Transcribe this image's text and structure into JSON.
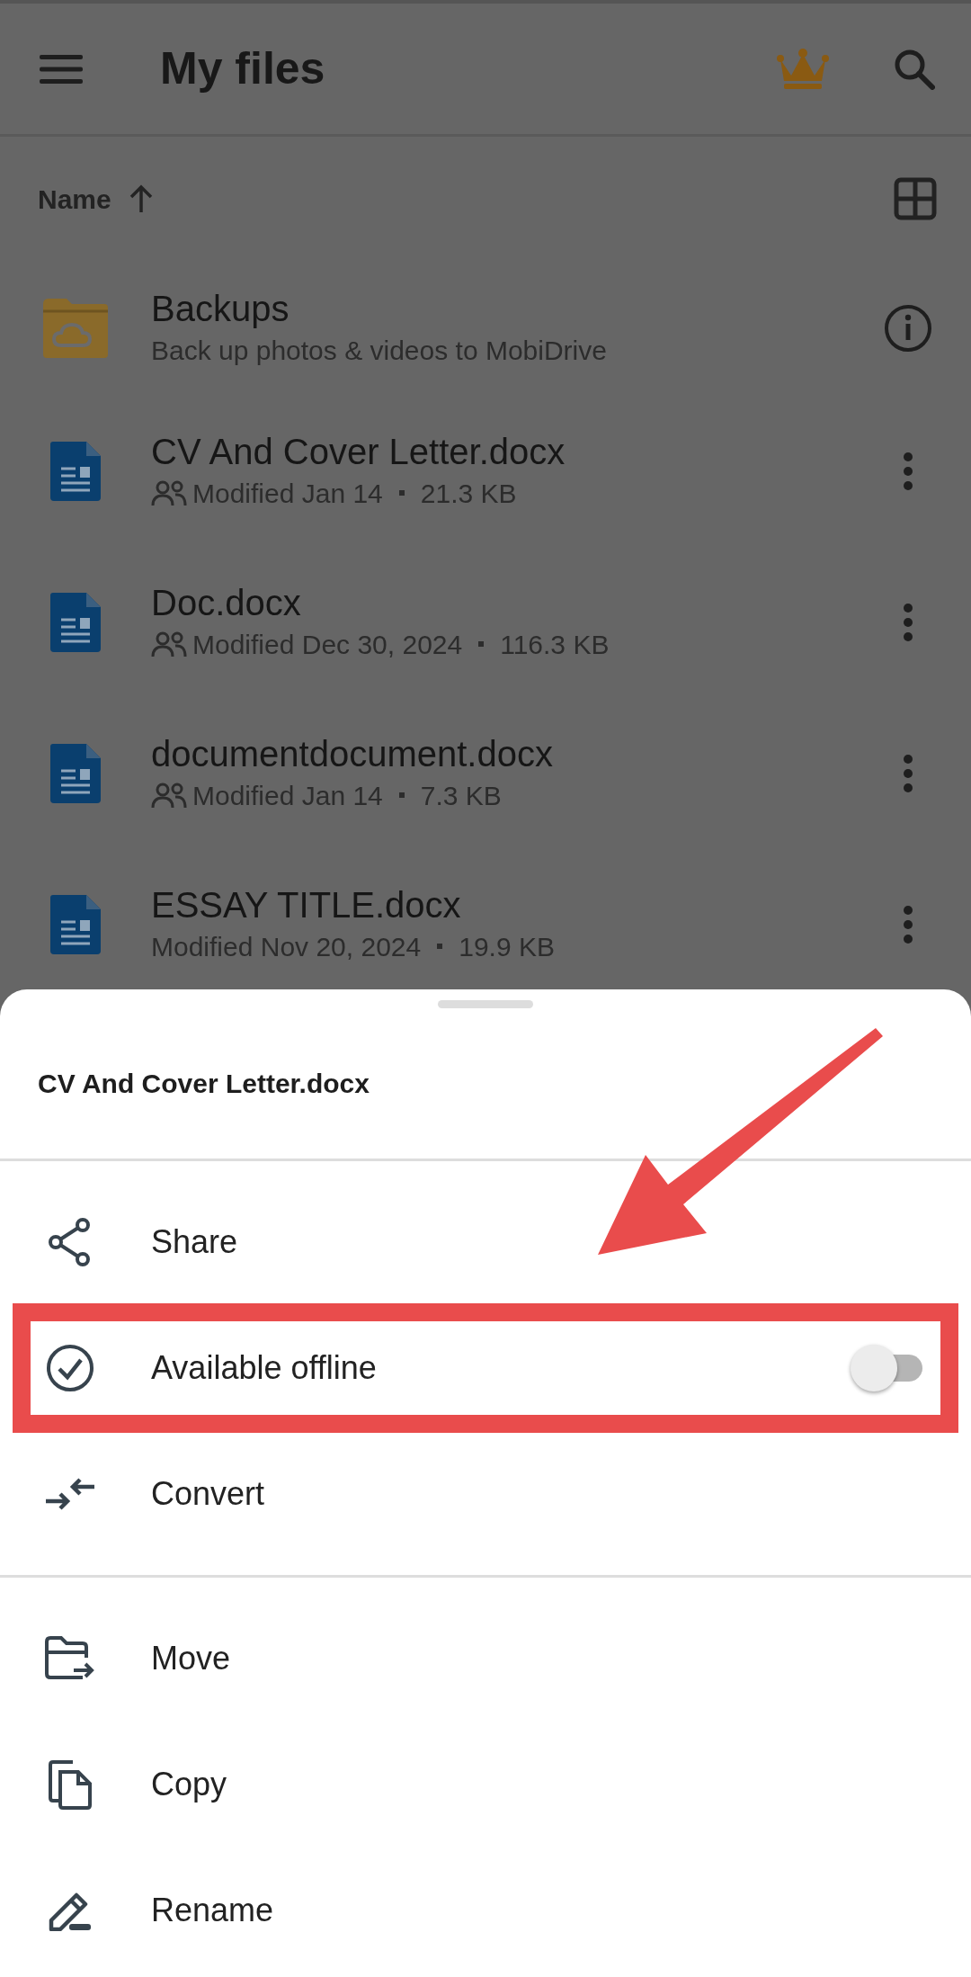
{
  "app_bar": {
    "title": "My files"
  },
  "sort": {
    "label": "Name"
  },
  "files": [
    {
      "kind": "folder",
      "name": "Backups",
      "detail": "Back up photos & videos to MobiDrive",
      "shared": false
    },
    {
      "kind": "doc",
      "name": "CV And Cover Letter.docx",
      "detail": "Modified Jan 14",
      "size": "21.3 KB",
      "shared": true
    },
    {
      "kind": "doc",
      "name": "Doc.docx",
      "detail": "Modified Dec 30, 2024",
      "size": "116.3 KB",
      "shared": true
    },
    {
      "kind": "doc",
      "name": "documentdocument.docx",
      "detail": "Modified Jan 14",
      "size": "7.3 KB",
      "shared": true
    },
    {
      "kind": "doc",
      "name": "ESSAY TITLE.docx",
      "detail": "Modified Nov 20, 2024",
      "size": "19.9 KB",
      "shared": false
    }
  ],
  "sheet": {
    "title": "CV And Cover Letter.docx",
    "sections": [
      [
        {
          "kind": "plain",
          "label": "Share",
          "highlighted": false
        },
        {
          "kind": "toggle",
          "label": "Available offline",
          "on": false,
          "highlighted": true
        },
        {
          "kind": "plain",
          "label": "Convert",
          "highlighted": false
        }
      ],
      [
        {
          "kind": "plain",
          "label": "Move",
          "highlighted": false
        },
        {
          "kind": "plain",
          "label": "Copy",
          "highlighted": false
        },
        {
          "kind": "plain",
          "label": "Rename",
          "highlighted": false
        }
      ]
    ]
  }
}
